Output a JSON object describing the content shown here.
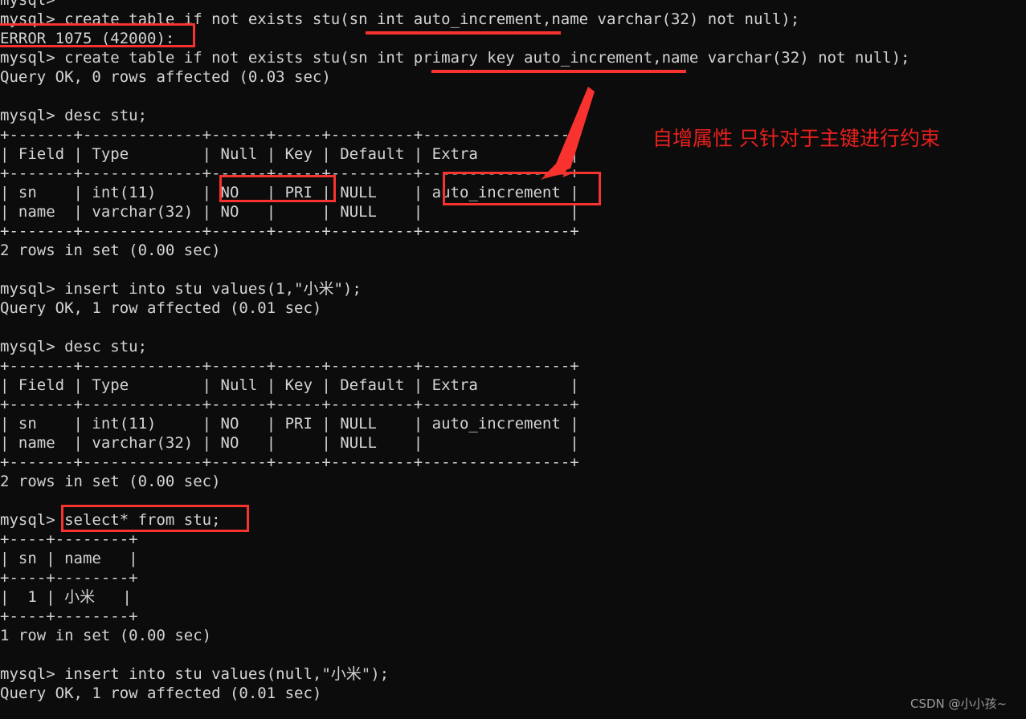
{
  "terminal": {
    "prompt": "mysql>",
    "lines": [
      "mysql>",
      "mysql> create table if not exists stu(sn int auto_increment,name varchar(32) not null);",
      "ERROR 1075 (42000):",
      "mysql> create table if not exists stu(sn int primary key auto_increment,name varchar(32) not null);",
      "Query OK, 0 rows affected (0.03 sec)",
      "",
      "mysql> desc stu;",
      "+-------+-------------+------+-----+---------+----------------+",
      "| Field | Type        | Null | Key | Default | Extra          |",
      "+-------+-------------+------+-----+---------+----------------+",
      "| sn    | int(11)     | NO   | PRI | NULL    | auto_increment |",
      "| name  | varchar(32) | NO   |     | NULL    |                |",
      "+-------+-------------+------+-----+---------+----------------+",
      "2 rows in set (0.00 sec)",
      "",
      "mysql> insert into stu values(1,\"小米\");",
      "Query OK, 1 row affected (0.01 sec)",
      "",
      "mysql> desc stu;",
      "+-------+-------------+------+-----+---------+----------------+",
      "| Field | Type        | Null | Key | Default | Extra          |",
      "+-------+-------------+------+-----+---------+----------------+",
      "| sn    | int(11)     | NO   | PRI | NULL    | auto_increment |",
      "| name  | varchar(32) | NO   |     | NULL    |                |",
      "+-------+-------------+------+-----+---------+----------------+",
      "2 rows in set (0.00 sec)",
      "",
      "mysql> select* from stu;",
      "+----+--------+",
      "| sn | name   |",
      "+----+--------+",
      "|  1 | 小米   |",
      "+----+--------+",
      "1 row in set (0.00 sec)",
      "",
      "mysql> insert into stu values(null,\"小米\");",
      "Query OK, 1 row affected (0.01 sec)"
    ]
  },
  "sql_statements": {
    "failed_create": "create table if not exists stu(sn int auto_increment,name varchar(32) not null);",
    "error_message": "ERROR 1075 (42000):",
    "ok_create": "create table if not exists stu(sn int primary key auto_increment,name varchar(32) not null);",
    "create_result": "Query OK, 0 rows affected (0.03 sec)",
    "desc": "desc stu;",
    "insert_literal": "insert into stu values(1,\"小米\");",
    "insert_result": "Query OK, 1 row affected (0.01 sec)",
    "select_all": "select* from stu;",
    "select_result": "1 row in set (0.00 sec)",
    "insert_null": "insert into stu values(null,\"小米\");",
    "insert_null_result": "Query OK, 1 row affected (0.01 sec)",
    "desc_result": "2 rows in set (0.00 sec)"
  },
  "desc_table": {
    "columns": [
      "Field",
      "Type",
      "Null",
      "Key",
      "Default",
      "Extra"
    ],
    "rows": [
      [
        "sn",
        "int(11)",
        "NO",
        "PRI",
        "NULL",
        "auto_increment"
      ],
      [
        "name",
        "varchar(32)",
        "NO",
        "",
        "NULL",
        ""
      ]
    ],
    "footer": "2 rows in set (0.00 sec)"
  },
  "select_table": {
    "columns": [
      "sn",
      "name"
    ],
    "rows": [
      [
        "1",
        "小米"
      ]
    ],
    "footer": "1 row in set (0.00 sec)"
  },
  "annotations": {
    "note_text": "自增属性 只针对于主键进行约束",
    "highlight_color": "#f8332f",
    "underline_color": "#f8332f",
    "boxes": [
      {
        "label": "error-1075-box"
      },
      {
        "label": "no-pri-box"
      },
      {
        "label": "auto-increment-box"
      },
      {
        "label": "select-statement-box"
      }
    ],
    "underlines": [
      {
        "label": "auto-increment-underline"
      },
      {
        "label": "primary-key-auto-increment-underline"
      }
    ],
    "arrow": {
      "label": "pointer-arrow-to-auto-increment"
    }
  },
  "watermark": {
    "text": "CSDN @小小孩~",
    "color": "#9a9a9a"
  }
}
